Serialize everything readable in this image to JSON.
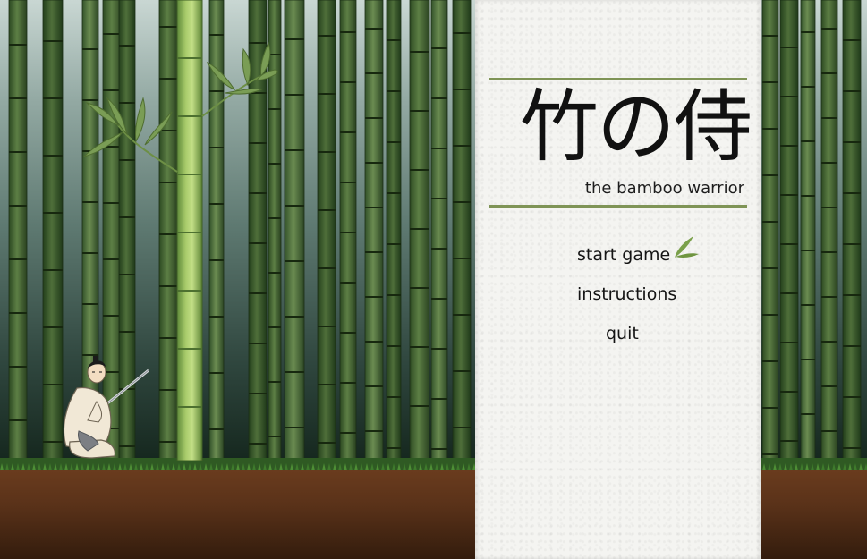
{
  "title": {
    "japanese": "竹の侍",
    "subtitle": "the bamboo warrior"
  },
  "menu": {
    "items": [
      {
        "id": "start",
        "label": "start game",
        "selected": true
      },
      {
        "id": "instructions",
        "label": "instructions",
        "selected": false
      },
      {
        "id": "quit",
        "label": "quit",
        "selected": false
      }
    ],
    "selection_icon": "bamboo-leaf-icon"
  },
  "colors": {
    "accent_rule": "#7f9456",
    "leaf_green": "#7aa04a",
    "panel_paper": "#f4f4f1",
    "ground_brown": "#5a3219"
  }
}
